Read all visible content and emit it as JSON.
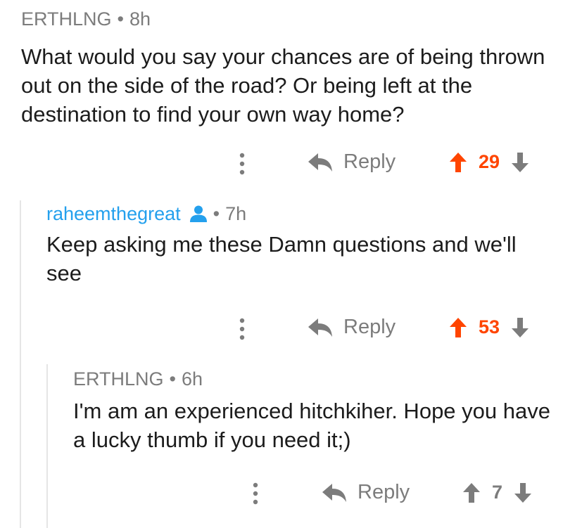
{
  "comments": [
    {
      "author": "ERTHLNG",
      "separator": "•",
      "time": "8h",
      "body": "What would you say your chances are of being thrown out on the side of the road? Or being left at the destination to find your own way home?",
      "reply_label": "Reply",
      "score": "29",
      "upvoted": true
    },
    {
      "author": "raheemthegreat",
      "separator": "•",
      "time": "7h",
      "body": "Keep asking me these Damn questions and we'll see",
      "reply_label": "Reply",
      "score": "53",
      "upvoted": true,
      "author_icon": "user-icon"
    },
    {
      "author": "ERTHLNG",
      "separator": "•",
      "time": "6h",
      "body": "I'm am an experienced hitchkiher. Hope you have a lucky thumb if you need it;)",
      "reply_label": "Reply",
      "score": "7",
      "upvoted": false
    }
  ],
  "colors": {
    "upvote": "#ff4500",
    "neutral": "#7c7c7c",
    "author_link": "#24a0ed",
    "thread_line": "#e5e5e5"
  },
  "icons": {
    "more": "more-vertical-icon",
    "reply": "reply-arrow-icon",
    "upvote": "upvote-arrow-icon",
    "downvote": "downvote-arrow-icon"
  }
}
